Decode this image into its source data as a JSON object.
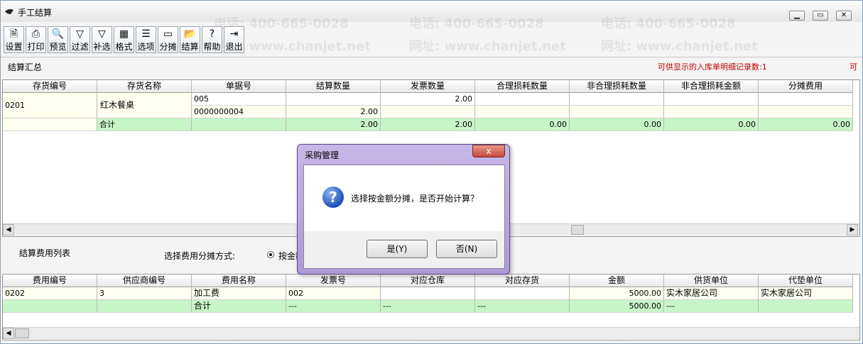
{
  "window": {
    "title": "手工结算"
  },
  "toolbar": [
    {
      "label": "设置",
      "icon": "settings-doc-icon",
      "glyph": "🗎"
    },
    {
      "label": "打印",
      "icon": "printer-icon",
      "glyph": "⎙"
    },
    {
      "label": "预览",
      "icon": "preview-icon",
      "glyph": "🔍"
    },
    {
      "label": "过滤",
      "icon": "filter-icon",
      "glyph": "▽"
    },
    {
      "label": "补选",
      "icon": "filter-add-icon",
      "glyph": "▽"
    },
    {
      "label": "格式",
      "icon": "format-icon",
      "glyph": "▦"
    },
    {
      "label": "选项",
      "icon": "options-icon",
      "glyph": "☰"
    },
    {
      "label": "分摊",
      "icon": "allocate-icon",
      "glyph": "▭"
    },
    {
      "label": "结算",
      "icon": "folder-open-icon",
      "glyph": "📂"
    },
    {
      "label": "帮助",
      "icon": "help-icon",
      "glyph": "?"
    },
    {
      "label": "退出",
      "icon": "exit-icon",
      "glyph": "⇥"
    }
  ],
  "summary": {
    "label": "结算汇总",
    "notice": "可供显示的入库单明细记录数:1",
    "notice_extra": "可",
    "columns": [
      "存货编号",
      "存货名称",
      "单据号",
      "结算数量",
      "发票数量",
      "合理损耗数量",
      "非合理损耗数量",
      "非合理损耗金额",
      "分摊费用"
    ],
    "item_code": "0201",
    "item_name": "红木餐桌",
    "doc_no_1": "005",
    "invoice_qty_1": "2.00",
    "doc_no_2": "0000000004",
    "settle_qty_2": "2.00",
    "total_label": "合计",
    "total_settle_qty": "2.00",
    "total_invoice_qty": "2.00",
    "total_reasonable_loss": "0.00",
    "total_unreasonable_loss_qty": "0.00",
    "total_unreasonable_loss_amt": "0.00",
    "total_allocated_fee": "0.00"
  },
  "fees": {
    "label": "结算费用列表",
    "method_label": "选择费用分摊方式:",
    "method_option": "按金额",
    "columns": [
      "费用编号",
      "供应商编号",
      "费用名称",
      "发票号",
      "对应仓库",
      "对应存货",
      "金额",
      "供货单位",
      "代垫单位"
    ],
    "row": {
      "code": "0202",
      "supplier_code": "3",
      "name": "加工费",
      "invoice_no": "002",
      "warehouse": "",
      "inventory": "",
      "amount": "5000.00",
      "supplier": "实木家居公司",
      "payer": "实木家居公司"
    },
    "total": {
      "label": "合计",
      "invoice_no": "---",
      "warehouse": "---",
      "inventory": "---",
      "amount": "5000.00",
      "supplier": "---"
    }
  },
  "dialog": {
    "title": "采购管理",
    "close_glyph": "x",
    "message": "选择按金额分摊，是否开始计算？",
    "yes_label": "是(Y)",
    "no_label": "否(N)"
  },
  "watermark": {
    "phone": "电话: 400-665-0028",
    "site": "网址: www.chanjet.net"
  },
  "colors": {
    "total_row": "#c8f5c8",
    "input_row": "#fffff0",
    "notice": "#c00000",
    "dialog_frame": "#b9a6df"
  }
}
